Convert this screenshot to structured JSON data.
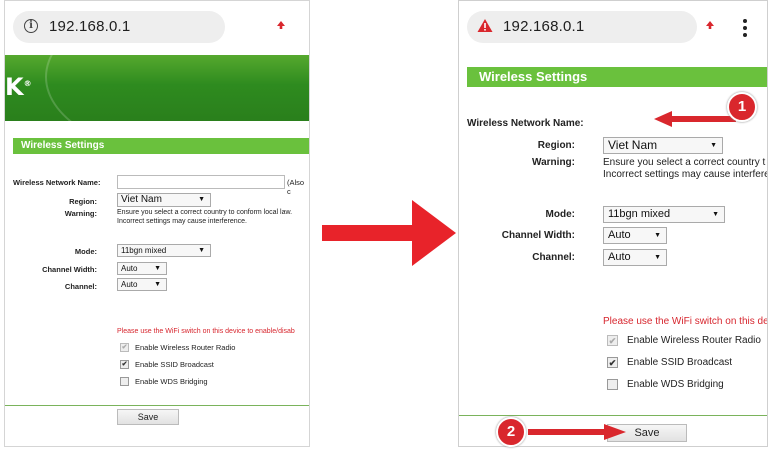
{
  "left": {
    "url": "192.168.0.1",
    "logo_text": "K",
    "section_title": "Wireless Settings",
    "network_name_label": "Wireless Network Name:",
    "network_name_hint": "(Also c",
    "region_label": "Region:",
    "region_value": "Viet Nam",
    "warning_label": "Warning:",
    "warning_line1": "Ensure you select a correct country to conform local law.",
    "warning_line2": "Incorrect settings may cause interference.",
    "mode_label": "Mode:",
    "mode_value": "11bgn mixed",
    "channel_width_label": "Channel Width:",
    "channel_width_value": "Auto",
    "channel_label": "Channel:",
    "channel_value": "Auto",
    "wifi_switch_note": "Please use the WiFi switch on this device to enable/disab",
    "opt_router_radio": "Enable Wireless Router Radio",
    "opt_ssid_broadcast": "Enable SSID Broadcast",
    "opt_wds_bridging": "Enable WDS Bridging",
    "save_label": "Save"
  },
  "right": {
    "url": "192.168.0.1",
    "section_title": "Wireless Settings",
    "network_name_label": "Wireless Network Name:",
    "region_label": "Region:",
    "region_value": "Viet Nam",
    "warning_label": "Warning:",
    "warning_line1": "Ensure you select a correct country t",
    "warning_line2": "Incorrect settings may cause interfere",
    "mode_label": "Mode:",
    "mode_value": "11bgn mixed",
    "channel_width_label": "Channel Width:",
    "channel_width_value": "Auto",
    "channel_label": "Channel:",
    "channel_value": "Auto",
    "wifi_switch_note": "Please use the WiFi switch on this dev",
    "opt_router_radio": "Enable Wireless Router Radio",
    "opt_ssid_broadcast": "Enable SSID Broadcast",
    "opt_wds_bridging": "Enable WDS Bridging",
    "save_label": "Save"
  },
  "annotations": {
    "marker_1": "1",
    "marker_2": "2"
  },
  "checkbox_states": {
    "router_radio": "checked-disabled",
    "ssid_broadcast": "checked",
    "wds_bridging": "unchecked"
  },
  "icons": {
    "left_url_icon": "info-icon",
    "right_url_icon": "warning-icon",
    "upload_icon": "arrow-up-icon",
    "menu_icon": "kebab-menu-icon",
    "transition_arrow": "right-arrow-icon"
  },
  "colors": {
    "banner_green": "#2e8b1f",
    "section_green": "#6ac13d",
    "note_red": "#d7262e",
    "annotation_red": "#d9272d"
  }
}
